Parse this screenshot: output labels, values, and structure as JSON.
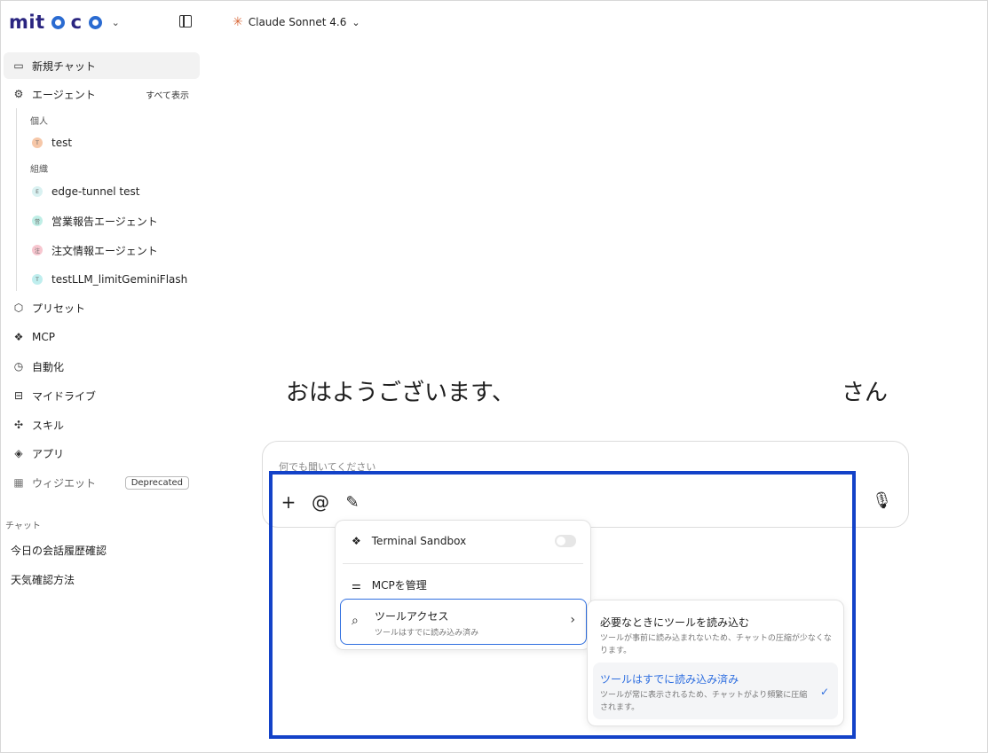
{
  "app": {
    "logo_text": "mitoco",
    "model_name": "Claude Sonnet 4.6"
  },
  "sidebar": {
    "new_chat": "新規チャット",
    "agents": "エージェント",
    "show_all": "すべて表示",
    "group_personal": "個人",
    "group_org": "組織",
    "personal_agents": [
      {
        "label": "test",
        "badge": "T",
        "color": "#f6c7a8"
      }
    ],
    "org_agents": [
      {
        "label": "edge-tunnel test",
        "badge": "E",
        "color": "#d9f1f1"
      },
      {
        "label": "営業報告エージェント",
        "badge": "営",
        "color": "#bfeee6"
      },
      {
        "label": "注文情報エージェント",
        "badge": "注",
        "color": "#f7c6cf"
      },
      {
        "label": "testLLM_limitGeminiFlash",
        "badge": "T",
        "color": "#bfeeee"
      }
    ],
    "presets": "プリセット",
    "mcp": "MCP",
    "automation": "自動化",
    "my_drive": "マイドライブ",
    "skills": "スキル",
    "apps": "アプリ",
    "widgets": "ウィジエット",
    "deprecated_badge": "Deprecated",
    "chat_section": "チャット",
    "chats": [
      "今日の会話履歴確認",
      "天気確認方法"
    ]
  },
  "main": {
    "greeting": "おはようございます、",
    "greeting_suffix": "さん",
    "input_placeholder": "何でも聞いてください"
  },
  "tool_menu": {
    "terminal_sandbox": "Terminal Sandbox",
    "terminal_sandbox_enabled": false,
    "manage_mcp": "MCPを管理",
    "tool_access_title": "ツールアクセス",
    "tool_access_sub": "ツールはすでに読み込み済み"
  },
  "submenu": {
    "option1_title": "必要なときにツールを読み込む",
    "option1_desc": "ツールが事前に読み込まれないため、チャットの圧縮が少なくなります。",
    "option2_title": "ツールはすでに読み込み済み",
    "option2_desc": "ツールが常に表示されるため、チャットがより頻繁に圧縮されます。",
    "selected": "option2"
  }
}
